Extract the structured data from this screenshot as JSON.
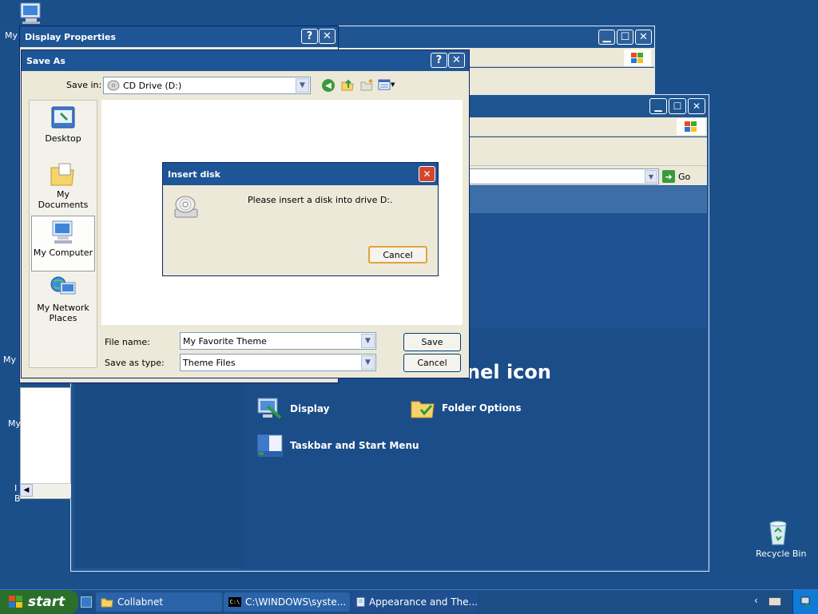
{
  "desktop": {
    "my_label": "My",
    "my_label_2": "My I",
    "my_label_3": "My",
    "frag_a": "I",
    "frag_b": "B",
    "recycle_bin": "Recycle Bin"
  },
  "control_panel_back": {
    "heading": "nel icon",
    "go_label": "Go",
    "links": [
      {
        "label": "Display"
      },
      {
        "label": "Folder Options"
      },
      {
        "label": "Taskbar and Start Menu"
      }
    ]
  },
  "display_properties": {
    "title": "Display Properties",
    "help": "?",
    "close": "✕"
  },
  "save_as": {
    "title": "Save As",
    "help": "?",
    "close": "✕",
    "save_in_label": "Save in:",
    "save_in_value": "CD Drive (D:)",
    "places": [
      {
        "label": "Desktop"
      },
      {
        "label": "My Documents"
      },
      {
        "label": "My Computer"
      },
      {
        "label": "My Network Places"
      }
    ],
    "file_name_label": "File name:",
    "file_name_value": "My Favorite Theme",
    "save_type_label": "Save as type:",
    "save_type_value": "Theme Files",
    "save_button": "Save",
    "cancel_button": "Cancel"
  },
  "insert_disk": {
    "title": "Insert disk",
    "message": "Please insert a disk into drive D:.",
    "cancel_button": "Cancel",
    "close": "✕"
  },
  "taskbar": {
    "start": "start",
    "tasks": [
      {
        "label": "Collabnet"
      },
      {
        "label": "C:\\WINDOWS\\syste..."
      },
      {
        "label": "Appearance and The..."
      }
    ]
  },
  "icons": {
    "computer": "computer-icon",
    "recycle": "recycle-bin-icon",
    "cd": "cd-drive-icon"
  }
}
